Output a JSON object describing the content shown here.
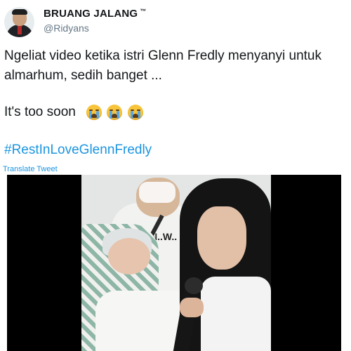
{
  "tweet": {
    "author": {
      "name": "BRUANG JALANG",
      "tm": "™",
      "handle": "@Ridyans"
    },
    "text_line1": "Ngeliat video ketika istri Glenn Fredly menyanyi untuk almarhum, sedih banget ...",
    "text_line2": "It's too soon",
    "emojis": [
      "loudly-crying-face",
      "loudly-crying-face",
      "loudly-crying-face"
    ],
    "hashtag": "#RestInLoveGlennFredly",
    "translate_label": "Translate Tweet"
  },
  "media": {
    "shirt_text": "N..W.."
  },
  "colors": {
    "link": "#1b95e0",
    "handle": "#657786",
    "text": "#14171a",
    "video_bg": "#000000"
  }
}
